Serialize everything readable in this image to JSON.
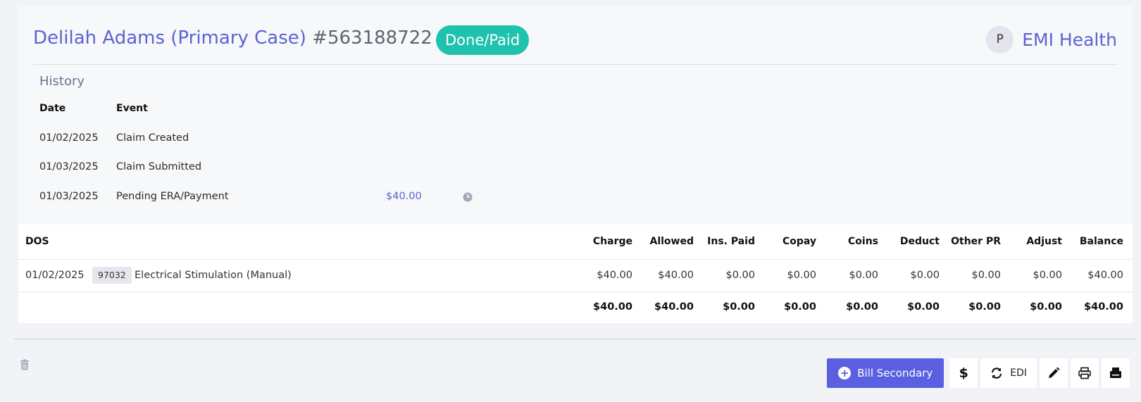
{
  "claim": {
    "patient_title": "Delilah Adams (Primary Case)",
    "claim_number": "#563188722",
    "status": "Done/Paid",
    "payer_initial": "P",
    "payer_name": "EMI Health"
  },
  "history": {
    "title": "History",
    "headers": {
      "date": "Date",
      "event": "Event"
    },
    "rows": [
      {
        "date": "01/02/2025",
        "event": "Claim Created",
        "amount": ""
      },
      {
        "date": "01/03/2025",
        "event": "Claim Submitted",
        "amount": ""
      },
      {
        "date": "01/03/2025",
        "event": "Pending ERA/Payment",
        "amount": "$40.00",
        "icon": "clock-icon"
      }
    ]
  },
  "service_lines": {
    "headers": {
      "dos": "DOS",
      "charge": "Charge",
      "allowed": "Allowed",
      "ins_paid": "Ins. Paid",
      "copay": "Copay",
      "coins": "Coins",
      "deduct": "Deduct",
      "other_pr": "Other PR",
      "adjust": "Adjust",
      "balance": "Balance"
    },
    "rows": [
      {
        "dos": "01/02/2025",
        "code": "97032",
        "description": "Electrical Stimulation (Manual)",
        "charge": "$40.00",
        "allowed": "$40.00",
        "ins_paid": "$0.00",
        "copay": "$0.00",
        "coins": "$0.00",
        "deduct": "$0.00",
        "other_pr": "$0.00",
        "adjust": "$0.00",
        "balance": "$40.00"
      }
    ],
    "totals": {
      "charge": "$40.00",
      "allowed": "$40.00",
      "ins_paid": "$0.00",
      "copay": "$0.00",
      "coins": "$0.00",
      "deduct": "$0.00",
      "other_pr": "$0.00",
      "adjust": "$0.00",
      "balance": "$40.00"
    }
  },
  "actions": {
    "bill_secondary": "Bill Secondary",
    "payment": "$",
    "edi": "EDI"
  },
  "colors": {
    "accent": "#5b63d3",
    "status_done": "#1fc2ad",
    "primary_button": "#5a60e0"
  }
}
